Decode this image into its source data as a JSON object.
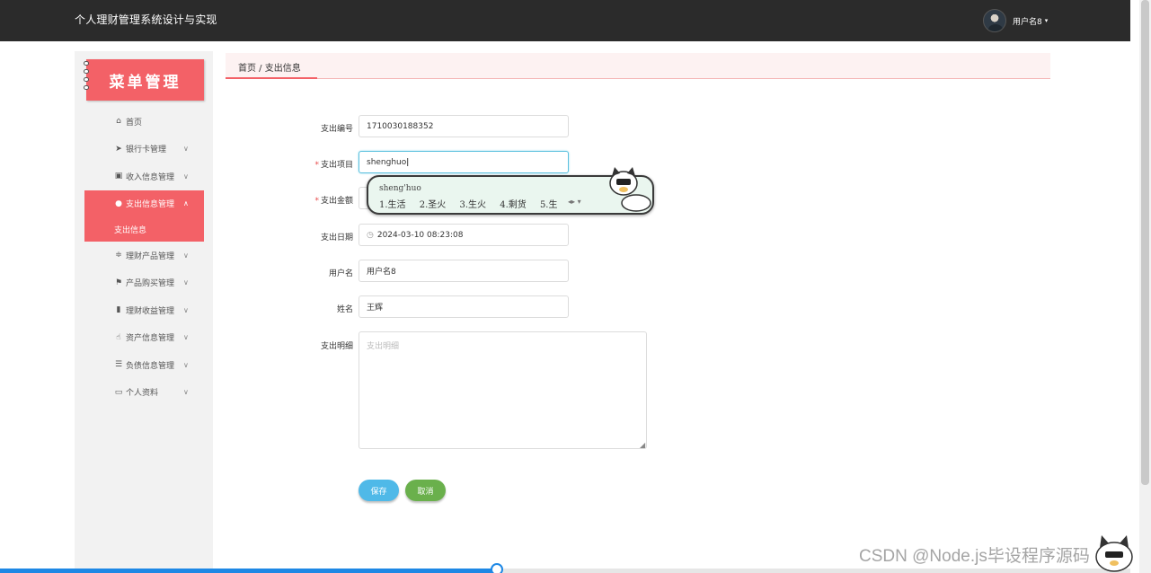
{
  "header": {
    "app_title": "个人理财管理系统设计与实现",
    "username": "用户名8",
    "caret_icon": "caret-down-icon"
  },
  "sidebar": {
    "logo_text": "菜单管理",
    "items": [
      {
        "label": "首页",
        "icon": "home-icon"
      },
      {
        "label": "银行卡管理",
        "icon": "send-icon"
      },
      {
        "label": "收入信息管理",
        "icon": "clipboard-icon"
      },
      {
        "label": "支出信息管理",
        "icon": "user-icon"
      },
      {
        "label": "理财产品管理",
        "icon": "sliders-icon"
      },
      {
        "label": "产品购买管理",
        "icon": "flag-icon"
      },
      {
        "label": "理财收益管理",
        "icon": "bar-chart-icon"
      },
      {
        "label": "资产信息管理",
        "icon": "thumbs-up-icon"
      },
      {
        "label": "负债信息管理",
        "icon": "list-icon"
      },
      {
        "label": "个人资料",
        "icon": "card-icon"
      }
    ],
    "active_submenu": "支出信息"
  },
  "breadcrumb": {
    "text": "首页 / 支出信息"
  },
  "form": {
    "expense_no_label": "支出编号",
    "expense_no_value": "1710030188352",
    "item_label": "支出项目",
    "item_value": "shenghuo",
    "amount_label": "支出金额",
    "amount_value": "",
    "date_label": "支出日期",
    "date_value": "2024-03-10 08:23:08",
    "username_label": "用户名",
    "username_value": "用户名8",
    "name_label": "姓名",
    "name_value": "王辉",
    "detail_label": "支出明细",
    "detail_placeholder": "支出明细",
    "required_mark": "*",
    "save_label": "保存",
    "cancel_label": "取消"
  },
  "ime": {
    "pinyin": "sheng'huo",
    "candidates": [
      "1.生活",
      "2.圣火",
      "3.生火",
      "4.剩货",
      "5.生"
    ]
  },
  "watermark": {
    "text": "CSDN @Node.js毕设程序源码"
  },
  "progress": {
    "fraction": 0.44
  },
  "colors": {
    "accent": "#f36167",
    "header_bg": "#2b2b2b",
    "save_button": "#4fb9e8",
    "cancel_button": "#6ab04c"
  }
}
